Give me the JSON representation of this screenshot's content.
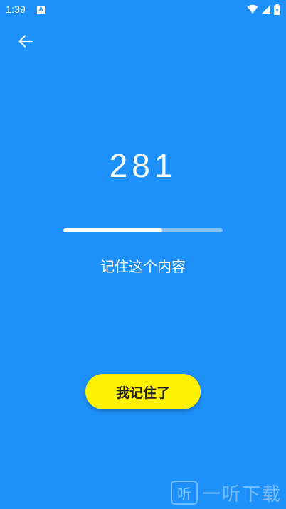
{
  "status_bar": {
    "time": "1:39",
    "notification_icon": "a-letter-icon",
    "notification_letter": "A",
    "icons": [
      "wifi-icon",
      "cell-signal-icon",
      "battery-icon"
    ]
  },
  "header": {
    "back_icon": "arrow-left-icon"
  },
  "main": {
    "number": "281",
    "progress": 0.62,
    "hint": "记住这个内容",
    "confirm_label": "我记住了"
  },
  "watermark": {
    "logo_text": "听",
    "text": "一听下载"
  },
  "colors": {
    "background": "#1e90fa",
    "button": "#fff200",
    "button_text": "#222222",
    "progress_track": "rgba(255,255,255,0.45)",
    "progress_fill": "#ffffff"
  }
}
